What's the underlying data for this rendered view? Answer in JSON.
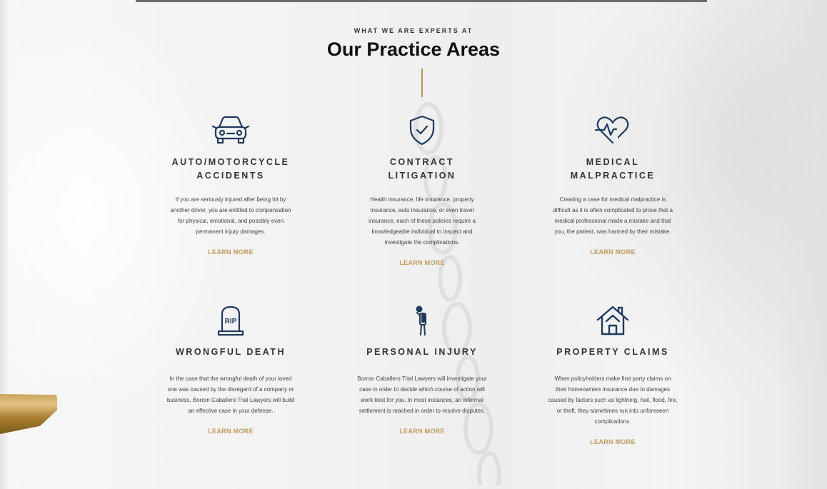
{
  "section": {
    "eyebrow": "WHAT WE ARE EXPERTS AT",
    "title": "Our Practice Areas"
  },
  "colors": {
    "accent": "#c29a62",
    "icon": "#1f3a5a",
    "heading": "#333333"
  },
  "cards": [
    {
      "icon": "car-icon",
      "title_line1": "AUTO/MOTORCYCLE",
      "title_line2": "ACCIDENTS",
      "desc_lines": [
        "If you are seriously injured after being hit by",
        "another driver, you are entitled to compensation",
        "for physical, emotional, and possibly even",
        "permanent injury damages."
      ],
      "link": "LEARN MORE"
    },
    {
      "icon": "shield-check-icon",
      "title_line1": "CONTRACT",
      "title_line2": "LITIGATION",
      "desc_lines": [
        "Health insurance, life insurance, property",
        "insurance, auto insurance, or even travel",
        "insurance, each of these policies require a",
        "knowledgeable individual to inspect and",
        "investigate the complications."
      ],
      "link": "LEARN MORE"
    },
    {
      "icon": "heartbeat-icon",
      "title_line1": "MEDICAL",
      "title_line2": "MALPRACTICE",
      "desc_lines": [
        "Creating a case for medical malpractice is",
        "difficult as it is often complicated to prove that a",
        "medical professional made a mistake and that",
        "you, the patient, was harmed by their mistake."
      ],
      "link": "LEARN MORE"
    },
    {
      "icon": "tombstone-icon",
      "icon_text": "RIP",
      "title_line1": "WRONGFUL DEATH",
      "desc_lines": [
        "In the case that the wrongful death of your loved",
        "one was caused by the disregard of a company or",
        "business, Borron Caballero Trial Lawyers will build",
        "an effective case in your defense."
      ],
      "link": "LEARN MORE"
    },
    {
      "icon": "injured-person-icon",
      "title_line1": "PERSONAL INJURY",
      "desc_lines": [
        "Borron Caballero Trial Lawyers will investigate your",
        "case in order to decide which course of action will",
        "work best for you. In most instances, an informal",
        "settlement is reached in order to resolve disputes."
      ],
      "link": "LEARN MORE"
    },
    {
      "icon": "house-icon",
      "title_line1": "PROPERTY CLAIMS",
      "desc_lines": [
        "When policyholders make first party claims on",
        "their homeowners insurance due to damages",
        "caused by factors such as lightning, hail, flood, fire,",
        "or theft, they sometimes run into unforeseen",
        "complications."
      ],
      "link": "LEARN MORE"
    }
  ]
}
